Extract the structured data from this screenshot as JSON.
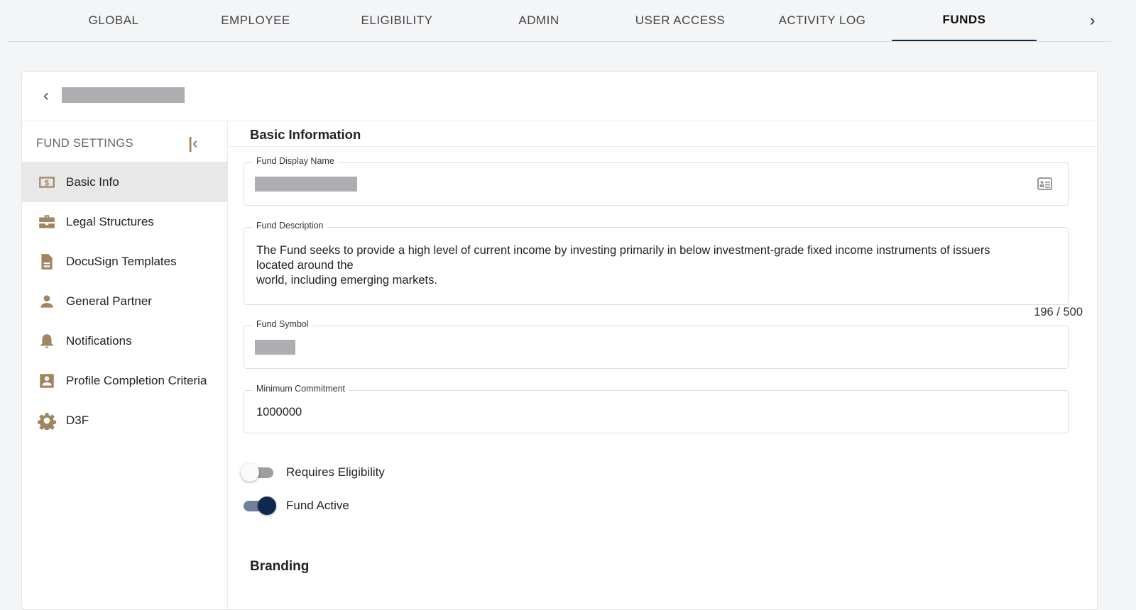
{
  "tabs": [
    {
      "label": "GLOBAL"
    },
    {
      "label": "EMPLOYEE"
    },
    {
      "label": "ELIGIBILITY"
    },
    {
      "label": "ADMIN"
    },
    {
      "label": "USER ACCESS"
    },
    {
      "label": "ACTIVITY LOG"
    },
    {
      "label": "FUNDS"
    }
  ],
  "tabs_next": "›",
  "sidebar": {
    "title": "FUND SETTINGS",
    "items": [
      {
        "label": "Basic Info"
      },
      {
        "label": "Legal Structures"
      },
      {
        "label": "DocuSign Templates"
      },
      {
        "label": "General Partner"
      },
      {
        "label": "Notifications"
      },
      {
        "label": "Profile Completion Criteria"
      },
      {
        "label": "D3F"
      }
    ]
  },
  "main": {
    "section_title": "Basic Information",
    "fields": {
      "display_name_label": "Fund Display Name",
      "description_label": "Fund Description",
      "description_line1": "The Fund seeks to provide a high level of current income by investing primarily in below investment-grade fixed income instruments of issuers",
      "description_line2": "located around the",
      "description_line3": "world, including emerging markets.",
      "description_counter": "196 / 500",
      "symbol_label": "Fund Symbol",
      "min_commitment_label": "Minimum Commitment",
      "min_commitment_value": "1000000"
    },
    "toggles": [
      {
        "label": "Requires Eligibility",
        "on": false
      },
      {
        "label": "Fund Active",
        "on": true
      }
    ],
    "branding_title": "Branding"
  },
  "colors": {
    "accent": "#a08560",
    "navy": "#0d2a4e"
  }
}
